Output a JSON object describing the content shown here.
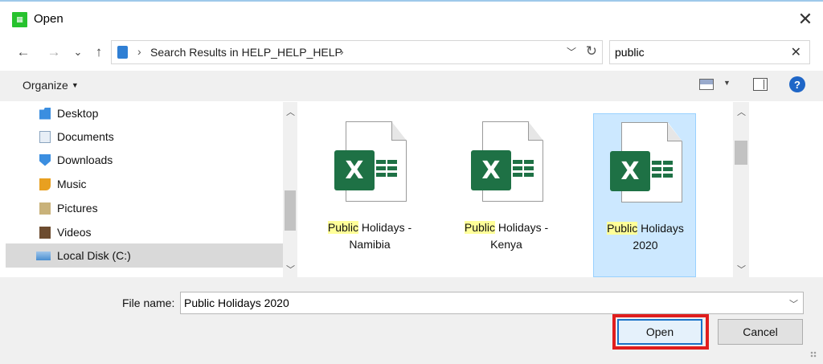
{
  "window": {
    "title": "Open",
    "close_glyph": "✕"
  },
  "nav": {
    "back": "←",
    "forward": "→",
    "recent": "⌄",
    "up": "↑"
  },
  "address": {
    "path": "Search Results in HELP_HELP_HELP",
    "sep": "›"
  },
  "search": {
    "value": "public",
    "clear_glyph": "✕"
  },
  "toolbar": {
    "organize_label": "Organize",
    "help_glyph": "?"
  },
  "sidebar": {
    "items": [
      {
        "label": "Desktop",
        "icon": "desktop-folder-icon",
        "color": "#3b8ee0"
      },
      {
        "label": "Documents",
        "icon": "documents-folder-icon",
        "color": "#8aa4bf"
      },
      {
        "label": "Downloads",
        "icon": "downloads-folder-icon",
        "color": "#3b8ee0"
      },
      {
        "label": "Music",
        "icon": "music-folder-icon",
        "color": "#e8a020"
      },
      {
        "label": "Pictures",
        "icon": "pictures-folder-icon",
        "color": "#c9b27a"
      },
      {
        "label": "Videos",
        "icon": "videos-folder-icon",
        "color": "#6d4c2f"
      },
      {
        "label": "Local Disk (C:)",
        "icon": "local-disk-icon",
        "color": "#4a8fd0"
      }
    ],
    "selected_index": 6
  },
  "files": [
    {
      "highlight": "Public",
      "rest_line1": " Holidays -",
      "line2": "Namibia",
      "selected": false
    },
    {
      "highlight": "Public",
      "rest_line1": " Holidays -",
      "line2": "Kenya",
      "selected": false
    },
    {
      "highlight": "Public",
      "rest_line1": " Holidays",
      "line2": "2020",
      "selected": true
    }
  ],
  "file_icon_letter": "X",
  "filename": {
    "label": "File name:",
    "value": "Public Holidays 2020"
  },
  "buttons": {
    "open_label": "Open",
    "cancel_label": "Cancel"
  },
  "colors": {
    "excel_green": "#1e7145",
    "selection": "#cce8ff",
    "search_highlight": "#ffff99",
    "annotation_red": "#e01e1e",
    "accent_blue": "#1f66c7"
  }
}
